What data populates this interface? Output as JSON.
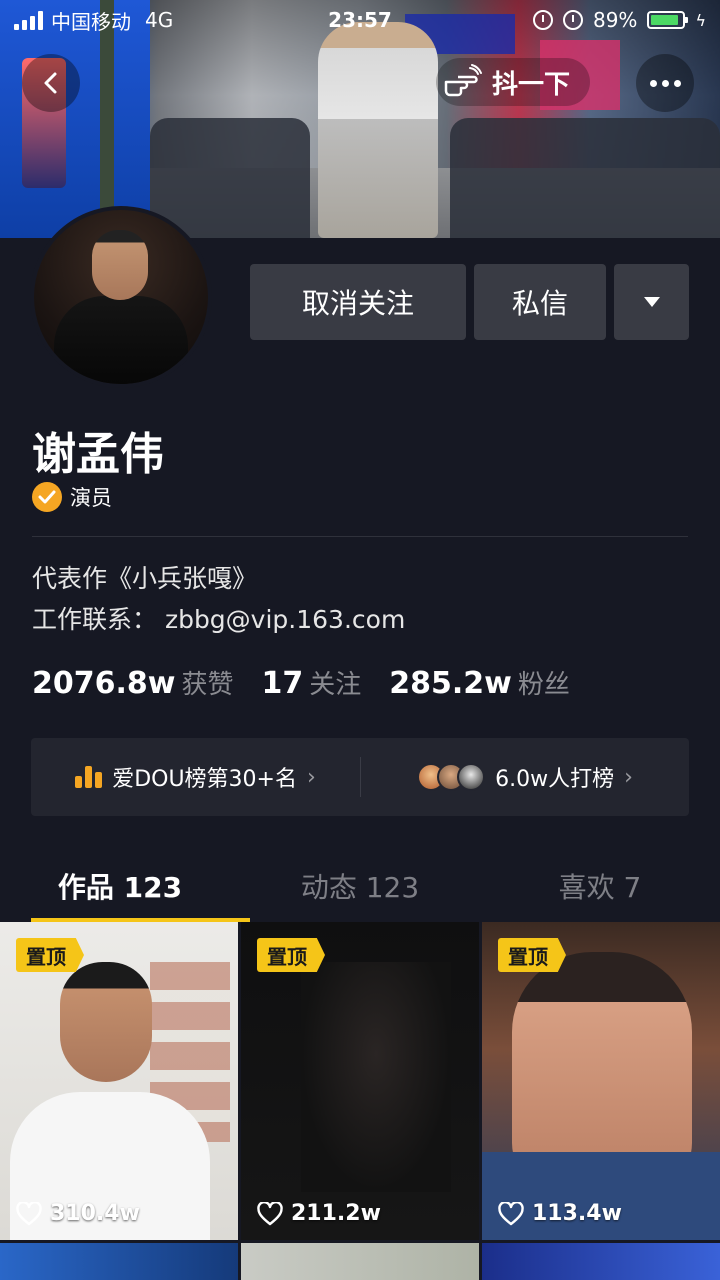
{
  "status_bar": {
    "carrier": "中国移动",
    "network": "4G",
    "time": "23:57",
    "battery_percent": "89%",
    "battery_level": 0.89,
    "battery_color": "#4cd964"
  },
  "nav": {
    "back_icon": "chevron-left-icon",
    "shake_label": "抖一下",
    "shake_icon": "hand-point-icon",
    "more_icon": "more-dots-icon"
  },
  "actions": {
    "unfollow_label": "取消关注",
    "message_label": "私信",
    "dropdown_icon": "triangle-down-icon"
  },
  "profile": {
    "name": "谢孟伟",
    "verify_label": "演员",
    "verify_icon": "check-badge-icon",
    "bio_line1": "代表作《小兵张嘎》",
    "bio_line2": "工作联系： zbbg@vip.163.com"
  },
  "stats": [
    {
      "value": "2076.8w",
      "label": "获赞"
    },
    {
      "value": "17",
      "label": "关注"
    },
    {
      "value": "285.2w",
      "label": "粉丝"
    }
  ],
  "rank": {
    "rank_label": "爱DOU榜第30+名",
    "supporters_label": "6.0w人打榜",
    "chevron": "›"
  },
  "tabs": [
    {
      "label": "作品 123",
      "active": true
    },
    {
      "label": "动态 123",
      "active": false
    },
    {
      "label": "喜欢 7",
      "active": false
    }
  ],
  "videos": [
    {
      "pinned_label": "置顶",
      "likes": "310.4w"
    },
    {
      "pinned_label": "置顶",
      "likes": "211.2w"
    },
    {
      "pinned_label": "置顶",
      "likes": "113.4w"
    }
  ],
  "colors": {
    "background": "#161823",
    "accent": "#f5c518",
    "verify": "#f5a623",
    "button_bg": "#393b44"
  }
}
